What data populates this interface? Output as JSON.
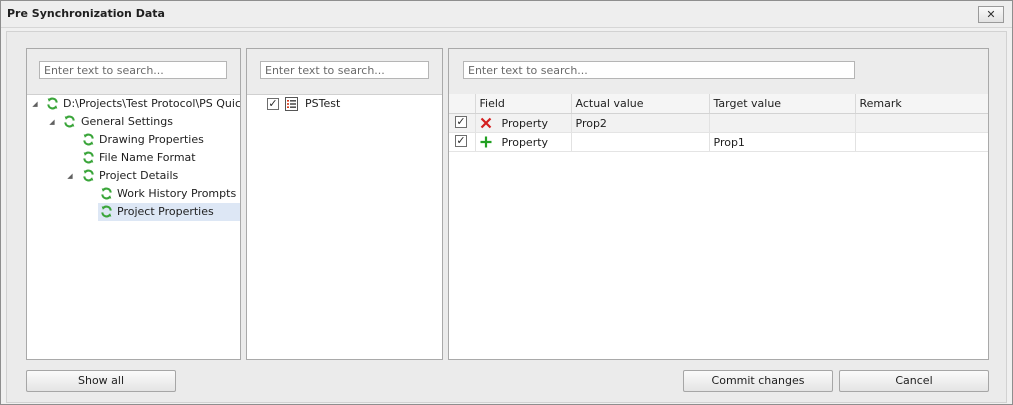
{
  "window": {
    "title": "Pre Synchronization Data",
    "close_glyph": "✕"
  },
  "left_panel": {
    "search_placeholder": "Enter text to search...",
    "tree": [
      {
        "label": "D:\\Projects\\Test Protocol\\PS Quick - T",
        "expanded": true,
        "icon": "sync-icon"
      },
      {
        "label": "General Settings",
        "expanded": true,
        "icon": "sync-icon"
      },
      {
        "label": "Drawing Properties",
        "icon": "sync-icon"
      },
      {
        "label": "File Name Format",
        "icon": "sync-icon"
      },
      {
        "label": "Project Details",
        "expanded": true,
        "icon": "sync-icon"
      },
      {
        "label": "Work History Prompts",
        "icon": "sync-icon"
      },
      {
        "label": "Project Properties",
        "icon": "sync-icon",
        "selected": true
      }
    ]
  },
  "middle_panel": {
    "search_placeholder": "Enter text to search...",
    "items": [
      {
        "label": "PSTest",
        "checked": true,
        "icon": "property-list-icon"
      }
    ]
  },
  "right_panel": {
    "search_placeholder": "Enter text to search...",
    "columns": [
      "Field",
      "Actual value",
      "Target value",
      "Remark"
    ],
    "rows": [
      {
        "checked": true,
        "action": "delete",
        "field": "Property",
        "actual": "Prop2",
        "target": "",
        "remark": ""
      },
      {
        "checked": true,
        "action": "add",
        "field": "Property",
        "actual": "",
        "target": "Prop1",
        "remark": ""
      }
    ]
  },
  "buttons": {
    "show_all": "Show all",
    "commit": "Commit changes",
    "cancel": "Cancel"
  },
  "colors": {
    "sync_icon": "#3aa53a",
    "delete_icon": "#d42020",
    "add_icon": "#22a022",
    "selection": "#dde7f5"
  }
}
